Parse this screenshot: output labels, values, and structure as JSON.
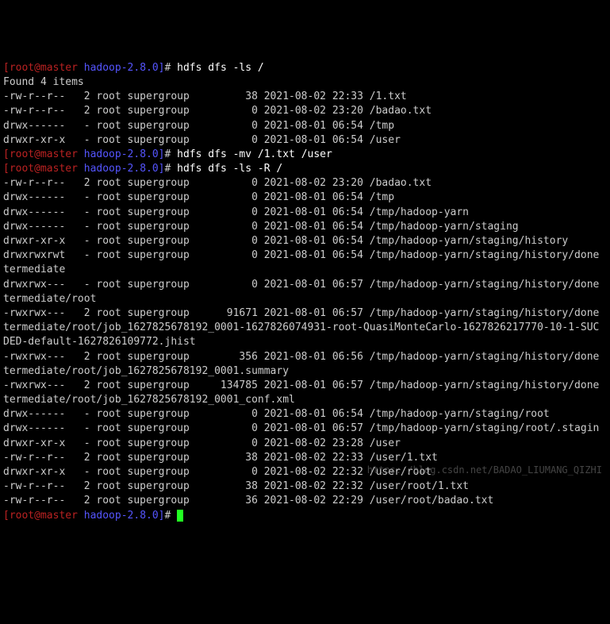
{
  "prompt": {
    "userhost": "[root@master",
    "dir": " hadoop-2.8.0]",
    "symbol": "# "
  },
  "commands": {
    "cmd1": "hdfs dfs -ls /",
    "cmd2": "hdfs dfs -mv /1.txt /user",
    "cmd3": "hdfs dfs -ls -R /",
    "cmd4": ""
  },
  "found": "Found 4 items",
  "ls1": [
    "-rw-r--r--   2 root supergroup         38 2021-08-02 22:33 /1.txt",
    "-rw-r--r--   2 root supergroup          0 2021-08-02 23:20 /badao.txt",
    "drwx------   - root supergroup          0 2021-08-01 06:54 /tmp",
    "drwxr-xr-x   - root supergroup          0 2021-08-01 06:54 /user"
  ],
  "ls2": [
    "-rw-r--r--   2 root supergroup          0 2021-08-02 23:20 /badao.txt",
    "drwx------   - root supergroup          0 2021-08-01 06:54 /tmp",
    "drwx------   - root supergroup          0 2021-08-01 06:54 /tmp/hadoop-yarn",
    "drwx------   - root supergroup          0 2021-08-01 06:54 /tmp/hadoop-yarn/staging",
    "drwxr-xr-x   - root supergroup          0 2021-08-01 06:54 /tmp/hadoop-yarn/staging/history",
    "drwxrwxrwt   - root supergroup          0 2021-08-01 06:54 /tmp/hadoop-yarn/staging/history/done\ntermediate",
    "drwxrwx---   - root supergroup          0 2021-08-01 06:57 /tmp/hadoop-yarn/staging/history/done\ntermediate/root",
    "-rwxrwx---   2 root supergroup      91671 2021-08-01 06:57 /tmp/hadoop-yarn/staging/history/done\ntermediate/root/job_1627825678192_0001-1627826074931-root-QuasiMonteCarlo-1627826217770-10-1-SUC\nDED-default-1627826109772.jhist",
    "-rwxrwx---   2 root supergroup        356 2021-08-01 06:56 /tmp/hadoop-yarn/staging/history/done\ntermediate/root/job_1627825678192_0001.summary",
    "-rwxrwx---   2 root supergroup     134785 2021-08-01 06:57 /tmp/hadoop-yarn/staging/history/done\ntermediate/root/job_1627825678192_0001_conf.xml",
    "drwx------   - root supergroup          0 2021-08-01 06:54 /tmp/hadoop-yarn/staging/root",
    "drwx------   - root supergroup          0 2021-08-01 06:57 /tmp/hadoop-yarn/staging/root/.stagin",
    "drwxr-xr-x   - root supergroup          0 2021-08-02 23:28 /user",
    "-rw-r--r--   2 root supergroup         38 2021-08-02 22:33 /user/1.txt",
    "drwxr-xr-x   - root supergroup          0 2021-08-02 22:32 /user/root",
    "-rw-r--r--   2 root supergroup         38 2021-08-02 22:32 /user/root/1.txt",
    "-rw-r--r--   2 root supergroup         36 2021-08-02 22:29 /user/root/badao.txt"
  ],
  "watermark": "https://blog.csdn.net/BADAO_LIUMANG_QIZHI"
}
